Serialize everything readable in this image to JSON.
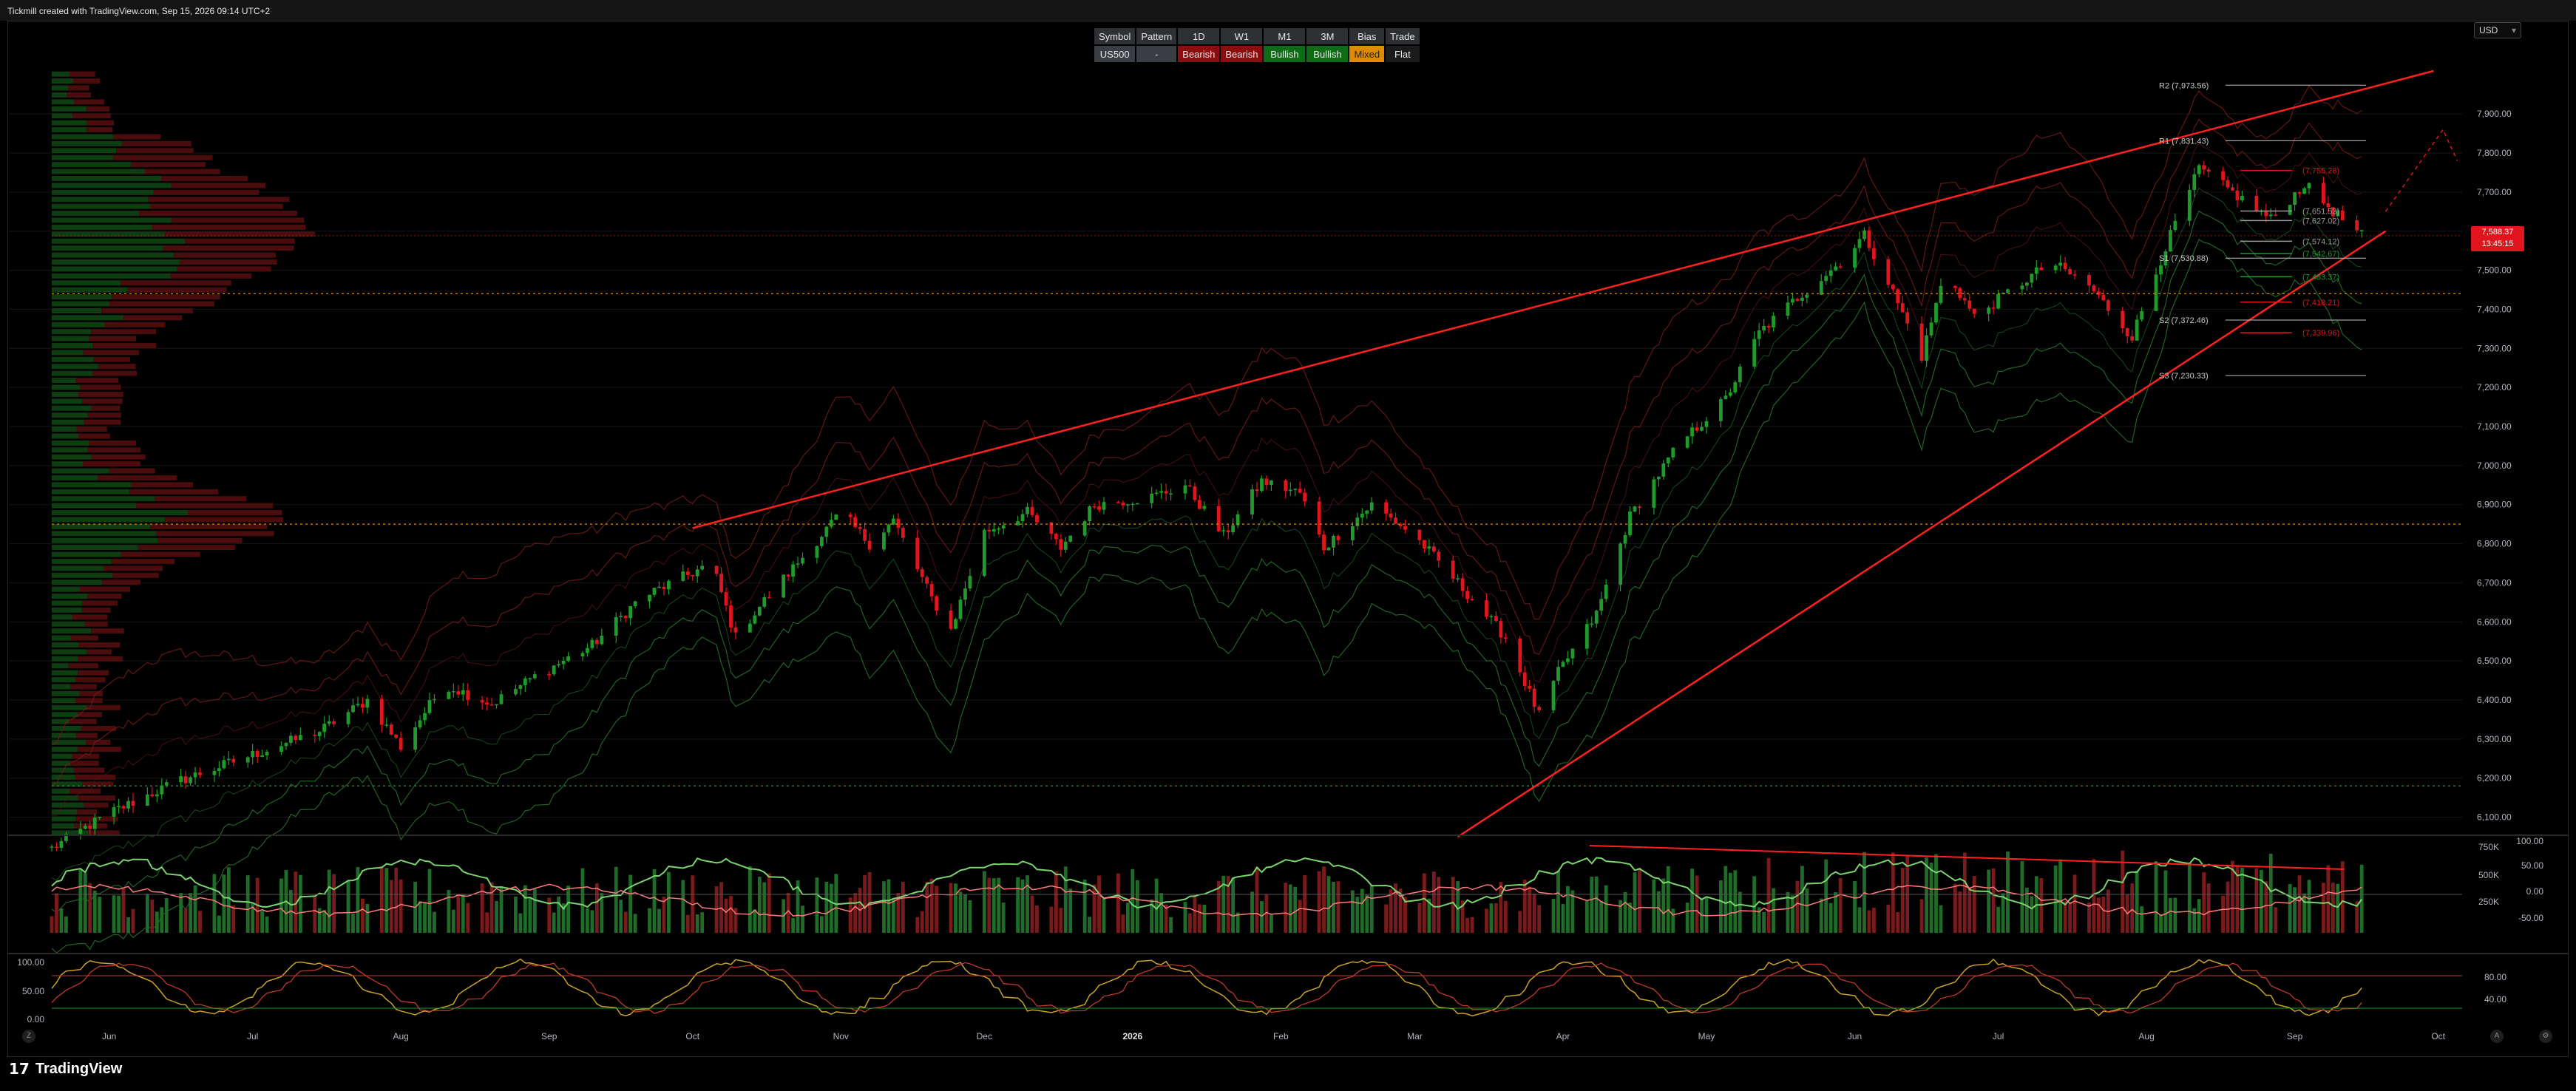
{
  "header": {
    "credit": "Tickmill created with TradingView.com, Sep 15, 2026 09:14 UTC+2"
  },
  "currency": "USD",
  "bias_table": {
    "headers": [
      "Symbol",
      "Pattern",
      "1D",
      "W1",
      "M1",
      "3M",
      "Bias",
      "Trade"
    ],
    "values": [
      "US500",
      "-",
      "Bearish",
      "Bearish",
      "Bullish",
      "Bullish",
      "Mixed",
      "Flat"
    ]
  },
  "price_tag": {
    "price": "7,588.37",
    "countdown": "13:45:15",
    "color": "#e0151d"
  },
  "footer": {
    "brand": "TradingView",
    "left_button": "Z",
    "right_buttons": [
      "A",
      "⚙"
    ]
  },
  "colors": {
    "bull": "#1f9b2b",
    "bear": "#e0151d",
    "bull_fill": "#0e3d12",
    "bear_fill": "#4a0c0c",
    "grid": "#161616",
    "axis_text": "#b2b5be",
    "level": "#c0c0c0",
    "accent_orange": "#e08a00"
  },
  "chart_data": [
    {
      "type": "candlestick",
      "symbol": "US500",
      "x_labels": [
        "Jun",
        "Jul",
        "Aug",
        "Sep",
        "Oct",
        "Nov",
        "Dec",
        "2026",
        "Feb",
        "Mar",
        "Apr",
        "May",
        "Jun",
        "Jul",
        "Aug",
        "Sep",
        "Oct"
      ],
      "y_ticks": [
        6100,
        6200,
        6300,
        6400,
        6500,
        6600,
        6700,
        6800,
        6900,
        7000,
        7100,
        7200,
        7300,
        7400,
        7500,
        7600,
        7700,
        7800,
        7900
      ],
      "y_tick_labels": [
        "6,100.00",
        "6,200.00",
        "6,300.00",
        "6,400.00",
        "6,500.00",
        "6,600.00",
        "6,700.00",
        "6,800.00",
        "6,900.00",
        "7,000.00",
        "7,100.00",
        "7,200.00",
        "7,300.00",
        "7,400.00",
        "7,500.00",
        "7,600.00",
        "7,700.00",
        "7,800.00",
        "7,900.00"
      ],
      "ylim": [
        6050,
        8010
      ],
      "close_path": [
        [
          "2025-05-20",
          6020
        ],
        [
          "2025-06-01",
          6110
        ],
        [
          "2025-06-15",
          6190
        ],
        [
          "2025-07-01",
          6260
        ],
        [
          "2025-07-15",
          6320
        ],
        [
          "2025-07-25",
          6400
        ],
        [
          "2025-08-01",
          6280
        ],
        [
          "2025-08-10",
          6440
        ],
        [
          "2025-08-20",
          6390
        ],
        [
          "2025-08-29",
          6460
        ],
        [
          "2025-09-10",
          6540
        ],
        [
          "2025-09-20",
          6660
        ],
        [
          "2025-09-30",
          6720
        ],
        [
          "2025-10-05",
          6750
        ],
        [
          "2025-10-10",
          6560
        ],
        [
          "2025-10-15",
          6640
        ],
        [
          "2025-10-25",
          6780
        ],
        [
          "2025-11-01",
          6880
        ],
        [
          "2025-11-07",
          6800
        ],
        [
          "2025-11-12",
          6860
        ],
        [
          "2025-11-20",
          6660
        ],
        [
          "2025-11-24",
          6580
        ],
        [
          "2025-12-01",
          6830
        ],
        [
          "2025-12-10",
          6880
        ],
        [
          "2025-12-17",
          6790
        ],
        [
          "2025-12-24",
          6900
        ],
        [
          "2026-01-05",
          6920
        ],
        [
          "2026-01-12",
          6950
        ],
        [
          "2026-01-20",
          6820
        ],
        [
          "2026-01-28",
          6960
        ],
        [
          "2026-02-05",
          6930
        ],
        [
          "2026-02-10",
          6790
        ],
        [
          "2026-02-20",
          6900
        ],
        [
          "2026-03-01",
          6820
        ],
        [
          "2026-03-10",
          6700
        ],
        [
          "2026-03-20",
          6560
        ],
        [
          "2026-03-27",
          6360
        ],
        [
          "2026-03-31",
          6470
        ],
        [
          "2026-04-08",
          6620
        ],
        [
          "2026-04-15",
          6870
        ],
        [
          "2026-04-25",
          7050
        ],
        [
          "2026-05-05",
          7170
        ],
        [
          "2026-05-12",
          7340
        ],
        [
          "2026-05-20",
          7430
        ],
        [
          "2026-05-29",
          7520
        ],
        [
          "2026-06-03",
          7590
        ],
        [
          "2026-06-08",
          7470
        ],
        [
          "2026-06-15",
          7280
        ],
        [
          "2026-06-20",
          7500
        ],
        [
          "2026-06-26",
          7380
        ],
        [
          "2026-07-05",
          7460
        ],
        [
          "2026-07-12",
          7520
        ],
        [
          "2026-07-20",
          7460
        ],
        [
          "2026-07-29",
          7330
        ],
        [
          "2026-08-05",
          7560
        ],
        [
          "2026-08-12",
          7760
        ],
        [
          "2026-08-20",
          7690
        ],
        [
          "2026-08-27",
          7630
        ],
        [
          "2026-09-03",
          7720
        ],
        [
          "2026-09-10",
          7640
        ],
        [
          "2026-09-15",
          7588
        ]
      ],
      "pivot_levels": [
        {
          "label": "R2 (7,973.56)",
          "value": 7973.56
        },
        {
          "label": "R1 (7,831.43)",
          "value": 7831.43
        },
        {
          "label": "S1 (7,530.88)",
          "value": 7530.88
        },
        {
          "label": "S2 (7,372.46)",
          "value": 7372.46
        },
        {
          "label": "S3 (7,230.33)",
          "value": 7230.33
        }
      ],
      "minor_levels": [
        {
          "label": "(7,755.28)",
          "value": 7755.28,
          "color": "#e0151d"
        },
        {
          "label": "(7,651.53)",
          "value": 7651.53,
          "color": "#9a9a9a"
        },
        {
          "label": "(7,627.02)",
          "value": 7627.02,
          "color": "#9a9a9a"
        },
        {
          "label": "(7,574.12)",
          "value": 7574.12,
          "color": "#9a9a9a"
        },
        {
          "label": "(7,542.67)",
          "value": 7542.67,
          "color": "#1f9b2b"
        },
        {
          "label": "(7,483.37)",
          "value": 7483.37,
          "color": "#1f9b2b"
        },
        {
          "label": "(7,418.21)",
          "value": 7418.21,
          "color": "#e0151d"
        },
        {
          "label": "(7,339.96)",
          "value": 7339.96,
          "color": "#e0151d"
        }
      ],
      "horizontal_levels": [
        7440,
        6850,
        6180
      ],
      "last_price": 7588.37,
      "volume_profile": "left",
      "trendlines": [
        {
          "from": [
            "2025-10-01",
            6840
          ],
          "to": [
            "2026-09-30",
            8010
          ]
        },
        {
          "from": [
            "2026-03-10",
            6050
          ],
          "to": [
            "2026-09-20",
            7600
          ]
        }
      ]
    },
    {
      "type": "bar+line",
      "name": "volume",
      "y_tick_labels": [
        "750K",
        "500K",
        "250K"
      ],
      "right_tick_labels": [
        "100.00",
        "50.00",
        "0.00",
        "-50.00"
      ]
    },
    {
      "type": "line",
      "name": "stochastic",
      "left_tick_labels": [
        "100.00",
        "50.00",
        "0.00"
      ],
      "right_tick_labels": [
        "80.00",
        "40.00"
      ]
    }
  ]
}
